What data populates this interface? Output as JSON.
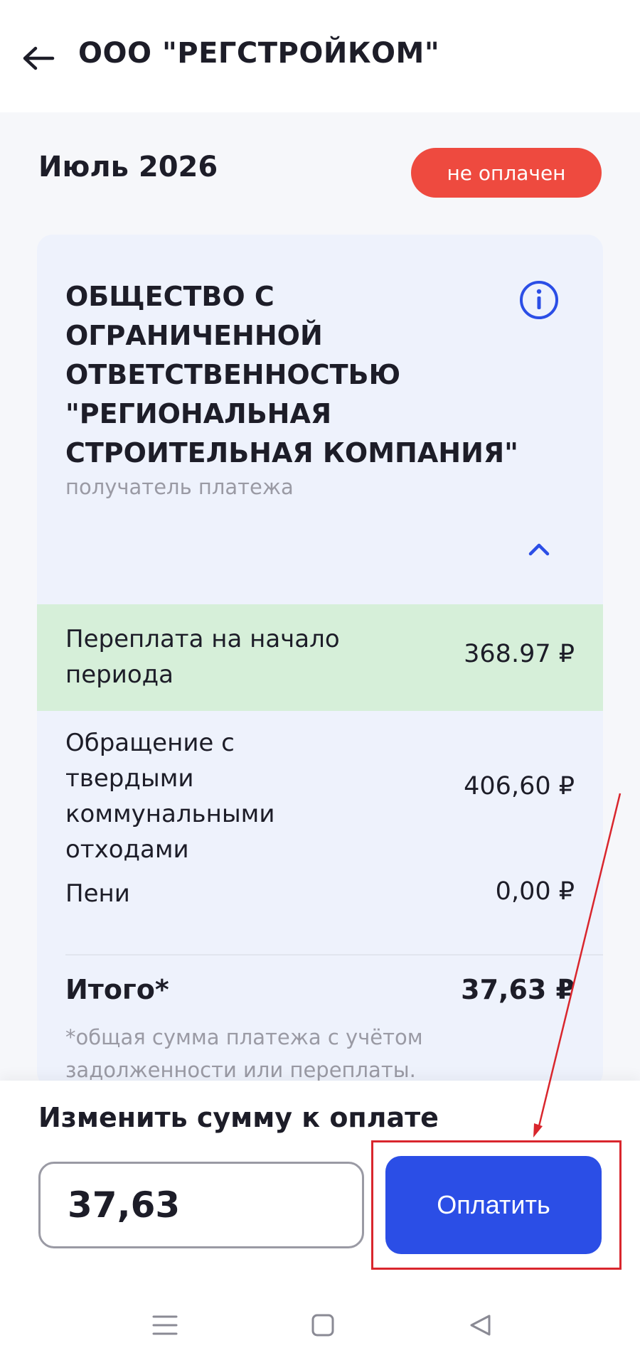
{
  "header": {
    "title": "ООО \"РЕГСТРОЙКОМ\"",
    "back_icon": "arrow-left-icon"
  },
  "invoice": {
    "period": "Июль 2026",
    "status": "не оплачен",
    "status_color": "#ee4a3f"
  },
  "recipient": {
    "name": "ОБЩЕСТВО С ОГРАНИЧЕННОЙ ОТВЕТСТВЕННОСТЬЮ \"РЕГИОНАЛЬНАЯ СТРОИТЕЛЬНАЯ КОМПАНИЯ\"",
    "caption": "получатель платежа",
    "info_icon": "info-icon",
    "collapse_icon": "chevron-up-icon"
  },
  "rows": [
    {
      "label": "Переплата на начало периода",
      "value": "368.97 ₽"
    },
    {
      "label": "Обращение с твердыми коммунальными отходами",
      "value": "406,60 ₽"
    },
    {
      "label": "Пени",
      "value": "0,00 ₽"
    }
  ],
  "total": {
    "label": "Итого*",
    "value": "37,63 ₽",
    "note": "*общая сумма платежа с учётом задолженности или переплаты."
  },
  "payment": {
    "change_label": "Изменить сумму к оплате",
    "amount": "37,63",
    "pay_label": "Оплатить",
    "accent_color": "#2b4ee6"
  },
  "nav": {
    "menu_icon": "menu-icon",
    "home_icon": "square-home-icon",
    "back_icon": "triangle-back-icon"
  }
}
